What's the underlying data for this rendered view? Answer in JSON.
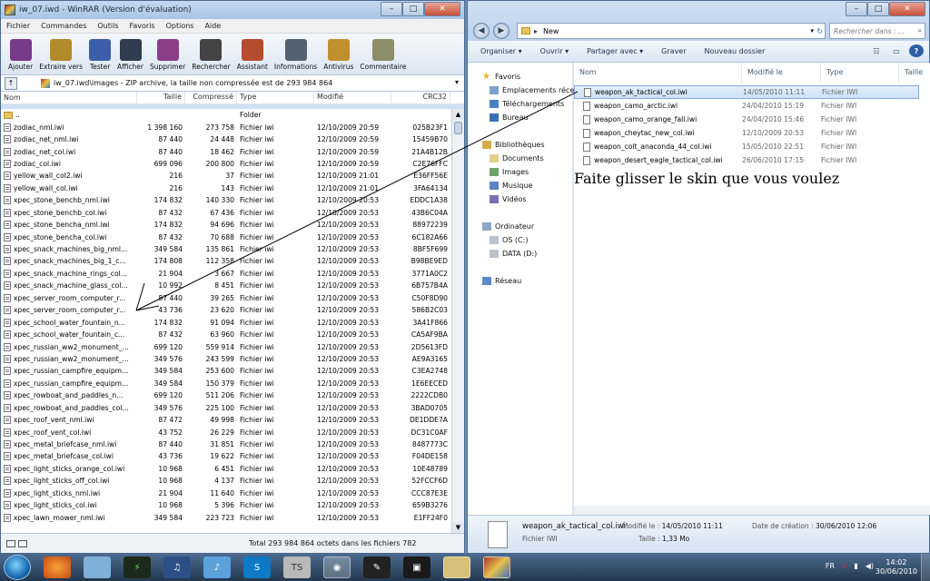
{
  "winrar": {
    "title": "iw_07.iwd - WinRAR (Version d'évaluation)",
    "menu": [
      "Fichier",
      "Commandes",
      "Outils",
      "Favoris",
      "Options",
      "Aide"
    ],
    "toolbar": [
      {
        "label": "Ajouter",
        "icon": "add-icon",
        "color": "#7a3a8c"
      },
      {
        "label": "Extraire vers",
        "icon": "extract-icon",
        "color": "#b38a2a"
      },
      {
        "label": "Tester",
        "icon": "test-icon",
        "color": "#3b5ea8"
      },
      {
        "label": "Afficher",
        "icon": "view-icon",
        "color": "#2f3b4e"
      },
      {
        "label": "Supprimer",
        "icon": "delete-icon",
        "color": "#8c3d8a"
      },
      {
        "label": "Rechercher",
        "icon": "find-icon",
        "color": "#444"
      },
      {
        "label": "Assistant",
        "icon": "wizard-icon",
        "color": "#b64c2e"
      },
      {
        "label": "Informations",
        "icon": "info-icon",
        "color": "#546170"
      },
      {
        "label": "Antivirus",
        "icon": "antivirus-icon",
        "color": "#c18f2e"
      },
      {
        "label": "Commentaire",
        "icon": "comment-icon",
        "color": "#8d8d6a"
      }
    ],
    "path": "iw_07.iwd\\images - ZIP archive, la taille non compressée est de 293 984 864",
    "columns": {
      "name": "Nom",
      "size": "Taille",
      "packed": "Compressé",
      "type": "Type",
      "modified": "Modifié",
      "crc": "CRC32"
    },
    "rows": [
      {
        "name": "..",
        "size": "",
        "packed": "",
        "type": "Folder",
        "modified": "",
        "crc": "",
        "folder": true
      },
      {
        "name": "zodiac_nml.iwi",
        "size": "1 398 160",
        "packed": "273 758",
        "type": "Fichier iwi",
        "modified": "12/10/2009 20:59",
        "crc": "025B23F1"
      },
      {
        "name": "zodiac_net_nml.iwi",
        "size": "87 440",
        "packed": "24 448",
        "type": "Fichier iwi",
        "modified": "12/10/2009 20:59",
        "crc": "15459B70"
      },
      {
        "name": "zodiac_net_col.iwi",
        "size": "87 440",
        "packed": "18 462",
        "type": "Fichier iwi",
        "modified": "12/10/2009 20:59",
        "crc": "21A4B12B"
      },
      {
        "name": "zodiac_col.iwi",
        "size": "699 096",
        "packed": "200 800",
        "type": "Fichier iwi",
        "modified": "12/10/2009 20:59",
        "crc": "C2E76FFC"
      },
      {
        "name": "yellow_wall_col2.iwi",
        "size": "216",
        "packed": "37",
        "type": "Fichier iwi",
        "modified": "12/10/2009 21:01",
        "crc": "E36FF56E"
      },
      {
        "name": "yellow_wall_col.iwi",
        "size": "216",
        "packed": "143",
        "type": "Fichier iwi",
        "modified": "12/10/2009 21:01",
        "crc": "3FA64134"
      },
      {
        "name": "xpec_stone_benchb_nml.iwi",
        "size": "174 832",
        "packed": "140 330",
        "type": "Fichier iwi",
        "modified": "12/10/2009 20:53",
        "crc": "EDDC1A38"
      },
      {
        "name": "xpec_stone_benchb_col.iwi",
        "size": "87 432",
        "packed": "67 436",
        "type": "Fichier iwi",
        "modified": "12/10/2009 20:53",
        "crc": "43B6C04A"
      },
      {
        "name": "xpec_stone_bencha_nml.iwi",
        "size": "174 832",
        "packed": "94 696",
        "type": "Fichier iwi",
        "modified": "12/10/2009 20:53",
        "crc": "88972239"
      },
      {
        "name": "xpec_stone_bencha_col.iwi",
        "size": "87 432",
        "packed": "70 688",
        "type": "Fichier iwi",
        "modified": "12/10/2009 20:53",
        "crc": "6C182A66"
      },
      {
        "name": "xpec_snack_machines_big_nml...",
        "size": "349 584",
        "packed": "135 861",
        "type": "Fichier iwi",
        "modified": "12/10/2009 20:53",
        "crc": "8BF5F699"
      },
      {
        "name": "xpec_snack_machines_big_1_c...",
        "size": "174 808",
        "packed": "112 358",
        "type": "Fichier iwi",
        "modified": "12/10/2009 20:53",
        "crc": "B98BE9ED"
      },
      {
        "name": "xpec_snack_machine_rings_col...",
        "size": "21 904",
        "packed": "3 667",
        "type": "Fichier iwi",
        "modified": "12/10/2009 20:53",
        "crc": "3771A0C2"
      },
      {
        "name": "xpec_snack_machine_glass_col...",
        "size": "10 992",
        "packed": "8 451",
        "type": "Fichier iwi",
        "modified": "12/10/2009 20:53",
        "crc": "6B757B4A"
      },
      {
        "name": "xpec_server_room_computer_r...",
        "size": "87 440",
        "packed": "39 265",
        "type": "Fichier iwi",
        "modified": "12/10/2009 20:53",
        "crc": "C50F8D90"
      },
      {
        "name": "xpec_server_room_computer_r...",
        "size": "43 736",
        "packed": "23 620",
        "type": "Fichier iwi",
        "modified": "12/10/2009 20:53",
        "crc": "586B2C03"
      },
      {
        "name": "xpec_school_water_fountain_n...",
        "size": "174 832",
        "packed": "91 094",
        "type": "Fichier iwi",
        "modified": "12/10/2009 20:53",
        "crc": "3A41F866"
      },
      {
        "name": "xpec_school_water_fountain_c...",
        "size": "87 432",
        "packed": "63 960",
        "type": "Fichier iwi",
        "modified": "12/10/2009 20:53",
        "crc": "CA5AF9BA"
      },
      {
        "name": "xpec_russian_ww2_monument_...",
        "size": "699 120",
        "packed": "559 914",
        "type": "Fichier iwi",
        "modified": "12/10/2009 20:53",
        "crc": "2D5613FD"
      },
      {
        "name": "xpec_russian_ww2_monument_...",
        "size": "349 576",
        "packed": "243 599",
        "type": "Fichier iwi",
        "modified": "12/10/2009 20:53",
        "crc": "AE9A3165"
      },
      {
        "name": "xpec_russian_campfire_equipm...",
        "size": "349 584",
        "packed": "253 600",
        "type": "Fichier iwi",
        "modified": "12/10/2009 20:53",
        "crc": "C3EA2748"
      },
      {
        "name": "xpec_russian_campfire_equipm...",
        "size": "349 584",
        "packed": "150 379",
        "type": "Fichier iwi",
        "modified": "12/10/2009 20:53",
        "crc": "1E6EECED"
      },
      {
        "name": "xpec_rowboat_and_paddles_n...",
        "size": "699 120",
        "packed": "511 206",
        "type": "Fichier iwi",
        "modified": "12/10/2009 20:53",
        "crc": "2222CDB0"
      },
      {
        "name": "xpec_rowboat_and_paddles_col...",
        "size": "349 576",
        "packed": "225 100",
        "type": "Fichier iwi",
        "modified": "12/10/2009 20:53",
        "crc": "3BAD0705"
      },
      {
        "name": "xpec_roof_vent_nml.iwi",
        "size": "87 472",
        "packed": "49 998",
        "type": "Fichier iwi",
        "modified": "12/10/2009 20:53",
        "crc": "DE1DDE7A"
      },
      {
        "name": "xpec_roof_vent_col.iwi",
        "size": "43 752",
        "packed": "26 229",
        "type": "Fichier iwi",
        "modified": "12/10/2009 20:53",
        "crc": "DC31C0AF"
      },
      {
        "name": "xpec_metal_briefcase_nml.iwi",
        "size": "87 440",
        "packed": "31 851",
        "type": "Fichier iwi",
        "modified": "12/10/2009 20:53",
        "crc": "8487773C"
      },
      {
        "name": "xpec_metal_briefcase_col.iwi",
        "size": "43 736",
        "packed": "19 622",
        "type": "Fichier iwi",
        "modified": "12/10/2009 20:53",
        "crc": "F04DE158"
      },
      {
        "name": "xpec_light_sticks_orange_col.iwi",
        "size": "10 968",
        "packed": "6 451",
        "type": "Fichier iwi",
        "modified": "12/10/2009 20:53",
        "crc": "10E48789"
      },
      {
        "name": "xpec_light_sticks_off_col.iwi",
        "size": "10 968",
        "packed": "4 137",
        "type": "Fichier iwi",
        "modified": "12/10/2009 20:53",
        "crc": "52FCCF6D"
      },
      {
        "name": "xpec_light_sticks_nml.iwi",
        "size": "21 904",
        "packed": "11 640",
        "type": "Fichier iwi",
        "modified": "12/10/2009 20:53",
        "crc": "CCC87E3E"
      },
      {
        "name": "xpec_light_sticks_col.iwi",
        "size": "10 968",
        "packed": "5 396",
        "type": "Fichier iwi",
        "modified": "12/10/2009 20:53",
        "crc": "659B3276"
      },
      {
        "name": "xpec_lawn_mower_nml.iwi",
        "size": "349 584",
        "packed": "223 723",
        "type": "Fichier iwi",
        "modified": "12/10/2009 20:53",
        "crc": "E1FF24F0"
      }
    ],
    "status": "Total 293 984 864 octets dans les fichiers 782"
  },
  "explorer": {
    "address": "New",
    "search_placeholder": "Rechercher dans : ...",
    "commands": [
      "Organiser ▾",
      "Ouvrir ▾",
      "Partager avec ▾",
      "Graver",
      "Nouveau dossier"
    ],
    "nav": {
      "favorites": "Favoris",
      "recent": "Emplacements réce",
      "downloads": "Téléchargements",
      "desktop": "Bureau",
      "libraries": "Bibliothèques",
      "documents": "Documents",
      "images": "Images",
      "music": "Musique",
      "videos": "Vidéos",
      "computer": "Ordinateur",
      "os_drive": "OS (C:)",
      "data_drive": "DATA (D:)",
      "network": "Réseau"
    },
    "columns": {
      "name": "Nom",
      "modified": "Modifié le",
      "type": "Type",
      "size": "Taille"
    },
    "files": [
      {
        "name": "weapon_ak_tactical_col.iwi",
        "modified": "14/05/2010 11:11",
        "type": "Fichier IWI"
      },
      {
        "name": "weapon_camo_arctic.iwi",
        "modified": "24/04/2010 15:19",
        "type": "Fichier IWI"
      },
      {
        "name": "weapon_camo_orange_fall.iwi",
        "modified": "24/04/2010 15:46",
        "type": "Fichier IWI"
      },
      {
        "name": "weapon_cheytac_new_col.iwi",
        "modified": "12/10/2009 20:53",
        "type": "Fichier IWI"
      },
      {
        "name": "weapon_colt_anaconda_44_col.iwi",
        "modified": "15/05/2010 22:51",
        "type": "Fichier IWI"
      },
      {
        "name": "weapon_desert_eagle_tactical_col.iwi",
        "modified": "26/06/2010 17:15",
        "type": "Fichier IWI"
      }
    ],
    "details": {
      "name": "weapon_ak_tactical_col.iwi",
      "type": "Fichier IWI",
      "modified_label": "Modifié le :",
      "modified_value": "14/05/2010 11:11",
      "size_label": "Taille :",
      "size_value": "1,33 Mo",
      "created_label": "Date de création :",
      "created_value": "30/06/2010 12:06"
    }
  },
  "annotation": "Faite glisser le skin que vous voulez",
  "taskbar": {
    "lang": "FR",
    "time": "14:02",
    "date": "30/06/2010"
  }
}
